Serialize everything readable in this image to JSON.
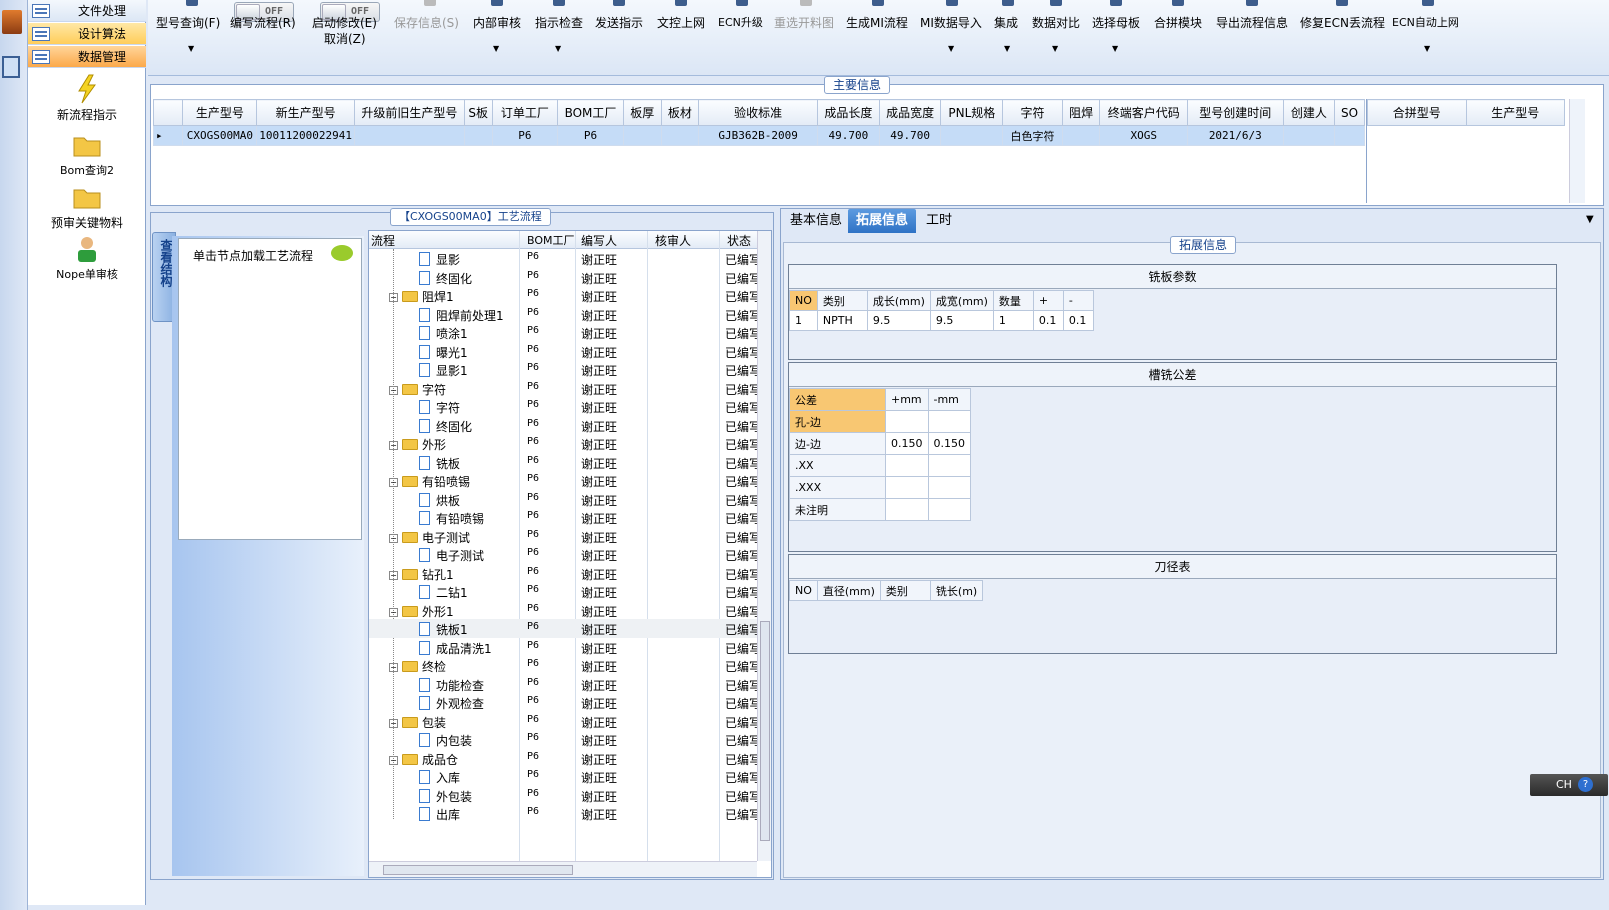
{
  "nav": {
    "groups": [
      "文件处理",
      "设计算法",
      "数据管理"
    ],
    "items": [
      "新流程指示",
      "Bom查询2",
      "预审关键物料",
      "Nope单审核"
    ]
  },
  "toolbar": {
    "buttons": [
      {
        "label": "型号查询(F)",
        "dd": true
      },
      {
        "label": "编写流程(R)",
        "toggle": "OFF"
      },
      {
        "label": "启动修改(E)",
        "sub": "取消(Z)",
        "toggle": "OFF"
      },
      {
        "label": "保存信息(S)",
        "disabled": true
      },
      {
        "label": "内部审核",
        "dd": true
      },
      {
        "label": "指示检查",
        "dd": true
      },
      {
        "label": "发送指示"
      },
      {
        "label": "文控上网"
      },
      {
        "label": "ECN升级"
      },
      {
        "label": "重选开料图",
        "disabled": true
      },
      {
        "label": "生成MI流程"
      },
      {
        "label": "MI数据导入",
        "dd": true
      },
      {
        "label": "集成",
        "dd": true
      },
      {
        "label": "数据对比",
        "dd": true
      },
      {
        "label": "选择母板",
        "dd": true
      },
      {
        "label": "合拼模块"
      },
      {
        "label": "导出流程信息"
      },
      {
        "label": "修复ECN丢流程"
      },
      {
        "label": "ECN自动上网",
        "dd": true
      }
    ]
  },
  "main_info": {
    "title": "主要信息",
    "columns": [
      "生产型号",
      "新生产型号",
      "升级前旧生产型号",
      "S板",
      "订单工厂",
      "BOM工厂",
      "板厚",
      "板材",
      "验收标准",
      "成品长度",
      "成品宽度",
      "PNL规格",
      "字符",
      "阻焊",
      "终端客户代码",
      "型号创建时间",
      "创建人",
      "SO"
    ],
    "row": [
      "CXOGS00MA0",
      "10011200022941",
      "",
      "",
      "P6",
      "P6",
      "",
      "",
      "GJB362B-2009",
      "49.700",
      "49.700",
      "",
      "白色字符",
      "",
      "XOGS",
      "2021/6/3",
      "",
      ""
    ],
    "merge_columns": [
      "合拼型号",
      "生产型号"
    ]
  },
  "process": {
    "title": "【CXOGS00MA0】工艺流程",
    "vtab": "查看结构",
    "hint": "单击节点加载工艺流程",
    "columns": [
      "流程",
      "BOM工厂",
      "编写人",
      "核审人",
      "状态"
    ],
    "rows": [
      {
        "name": "显影",
        "lvl": 2
      },
      {
        "name": "终固化",
        "lvl": 2
      },
      {
        "name": "阻焊1",
        "lvl": 1
      },
      {
        "name": "阻焊前处理1",
        "lvl": 2
      },
      {
        "name": "喷涂1",
        "lvl": 2
      },
      {
        "name": "曝光1",
        "lvl": 2
      },
      {
        "name": "显影1",
        "lvl": 2
      },
      {
        "name": "字符",
        "lvl": 1
      },
      {
        "name": "字符",
        "lvl": 2
      },
      {
        "name": "终固化",
        "lvl": 2
      },
      {
        "name": "外形",
        "lvl": 1
      },
      {
        "name": "铣板",
        "lvl": 2
      },
      {
        "name": "有铅喷锡",
        "lvl": 1
      },
      {
        "name": "烘板",
        "lvl": 2
      },
      {
        "name": "有铅喷锡",
        "lvl": 2
      },
      {
        "name": "电子测试",
        "lvl": 1
      },
      {
        "name": "电子测试",
        "lvl": 2
      },
      {
        "name": "钻孔1",
        "lvl": 1
      },
      {
        "name": "二钻1",
        "lvl": 2
      },
      {
        "name": "外形1",
        "lvl": 1
      },
      {
        "name": "铣板1",
        "lvl": 2
      },
      {
        "name": "成品清洗1",
        "lvl": 2
      },
      {
        "name": "终检",
        "lvl": 1
      },
      {
        "name": "功能检查",
        "lvl": 2
      },
      {
        "name": "外观检查",
        "lvl": 2
      },
      {
        "name": "包装",
        "lvl": 1
      },
      {
        "name": "内包装",
        "lvl": 2
      },
      {
        "name": "成品仓",
        "lvl": 1
      },
      {
        "name": "入库",
        "lvl": 2
      },
      {
        "name": "外包装",
        "lvl": 2
      },
      {
        "name": "出库",
        "lvl": 2
      }
    ],
    "factory": "P6",
    "writer": "谢正旺",
    "status": "已编写"
  },
  "right": {
    "tabs": [
      "基本信息",
      "拓展信息",
      "工时"
    ],
    "panel_title": "拓展信息",
    "mill": {
      "title": "铣板参数",
      "columns": [
        "NO",
        "类别",
        "成长(mm)",
        "成宽(mm)",
        "数量",
        "+",
        "-"
      ],
      "row": [
        "1",
        "NPTH",
        "9.5",
        "9.5",
        "1",
        "0.1",
        "0.1"
      ]
    },
    "slot": {
      "title": "槽铣公差",
      "head": [
        "公差",
        "+mm",
        "-mm"
      ],
      "rows": [
        [
          "孔-边",
          "",
          ""
        ],
        [
          "边-边",
          "0.150",
          "0.150"
        ],
        [
          ".XX",
          "",
          ""
        ],
        [
          ".XXX",
          "",
          ""
        ],
        [
          "未注明",
          "",
          ""
        ]
      ]
    },
    "tool": {
      "title": "刀径表",
      "columns": [
        "NO",
        "直径(mm)",
        "类别",
        "铣长(m)"
      ]
    }
  },
  "ime": {
    "label": "CH"
  }
}
